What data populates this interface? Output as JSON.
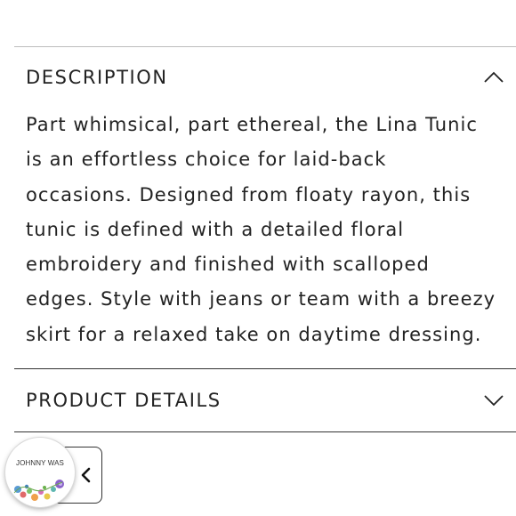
{
  "description": {
    "title": "DESCRIPTION",
    "expanded": true,
    "toggle_icon": "chevron-up-icon",
    "body": "Part whimsical, part ethereal, the Lina Tunic\nis an effortless choice for laid-back\noccasions. Designed from floaty rayon, this\ntunic is defined with a detailed floral\nembroidery and finished with scalloped\nedges. Style with jeans or team with a breezy\nskirt for a relaxed take on daytime dressing."
  },
  "product_details": {
    "title": "PRODUCT DETAILS",
    "expanded": false,
    "toggle_icon": "chevron-down-icon"
  },
  "brand_badge": {
    "text": "JOHNNY WAS",
    "icon": "floral-logo"
  },
  "collapse_tab": {
    "icon": "chevron-left-icon"
  },
  "colors": {
    "text": "#222222",
    "divider": "#333333",
    "background": "#ffffff"
  }
}
